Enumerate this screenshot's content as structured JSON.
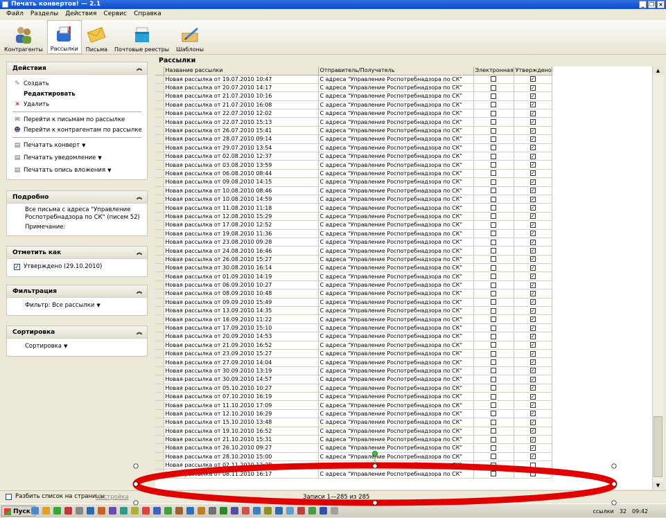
{
  "window": {
    "title": "Печать конвертов! — 2.1"
  },
  "menu": [
    "Файл",
    "Разделы",
    "Действия",
    "Сервис",
    "Справка"
  ],
  "toolbar": [
    {
      "label": "Контрагенты",
      "icon": "contacts-icon"
    },
    {
      "label": "Рассылки",
      "icon": "mailbox-icon",
      "active": true
    },
    {
      "label": "Письма",
      "icon": "envelope-icon"
    },
    {
      "label": "Почтовые реестры",
      "icon": "postal-registry-icon"
    },
    {
      "label": "Шаблоны",
      "icon": "templates-icon"
    }
  ],
  "panels": {
    "actions": {
      "title": "Действия",
      "create": "Создать",
      "edit": "Редактировать",
      "delete": "Удалить",
      "goto_letters": "Перейти к письмам по рассылке",
      "goto_contractors": "Перейти к контрагентам по рассылке",
      "print_envelope": "Печатать конверт",
      "print_notice": "Печатать уведомление",
      "print_inventory": "Печатать опись вложения"
    },
    "details": {
      "title": "Подробно",
      "text": "Все письма с адреса \"Управление Роспотребнадзора по СК\" (писем 52)",
      "note": "Примечание:"
    },
    "mark": {
      "title": "Отметить как",
      "approved": "Утверждено (29.10.2010)"
    },
    "filter": {
      "title": "Фильтрация",
      "label": "Фильтр: Все рассылки"
    },
    "sort": {
      "title": "Сортировка",
      "label": "Сортировка"
    }
  },
  "main": {
    "title": "Рассылки",
    "columns": [
      "Название рассылки",
      "Отправитель/Получатель",
      "Электронная",
      "Утверждено"
    ],
    "sender": "С адреса \"Управление Роспотребнадзора по СК\"",
    "rows": [
      {
        "name": "Новая рассылка от 19.07.2010 10:47",
        "electronic": false,
        "approved": true
      },
      {
        "name": "Новая рассылка от 20.07.2010 14:17",
        "electronic": false,
        "approved": true
      },
      {
        "name": "Новая рассылка от 21.07.2010 10:16",
        "electronic": false,
        "approved": true
      },
      {
        "name": "Новая рассылка от 21.07.2010 16:08",
        "electronic": false,
        "approved": true
      },
      {
        "name": "Новая рассылка от 22.07.2010 12:02",
        "electronic": false,
        "approved": true
      },
      {
        "name": "Новая рассылка от 22.07.2010 15:13",
        "electronic": false,
        "approved": true
      },
      {
        "name": "Новая рассылка от 26.07.2010 15:41",
        "electronic": false,
        "approved": true
      },
      {
        "name": "Новая рассылка от 28.07.2010 09:14",
        "electronic": false,
        "approved": true
      },
      {
        "name": "Новая рассылка от 29.07.2010 13:54",
        "electronic": false,
        "approved": true
      },
      {
        "name": "Новая рассылка от 02.08.2010 12:37",
        "electronic": false,
        "approved": true
      },
      {
        "name": "Новая рассылка от 03.08.2010 13:59",
        "electronic": false,
        "approved": true
      },
      {
        "name": "Новая рассылка от 06.08.2010 08:44",
        "electronic": false,
        "approved": true
      },
      {
        "name": "Новая рассылка от 09.08.2010 14:15",
        "electronic": false,
        "approved": true
      },
      {
        "name": "Новая рассылка от 10.08.2010 08:46",
        "electronic": false,
        "approved": true
      },
      {
        "name": "Новая рассылка от 10.08.2010 14:59",
        "electronic": false,
        "approved": true
      },
      {
        "name": "Новая рассылка от 11.08.2010 11:18",
        "electronic": false,
        "approved": true
      },
      {
        "name": "Новая рассылка от 12.08.2010 15:29",
        "electronic": false,
        "approved": true
      },
      {
        "name": "Новая рассылка от 17.08.2010 12:52",
        "electronic": false,
        "approved": true
      },
      {
        "name": "Новая рассылка от 19.08.2010 11:36",
        "electronic": false,
        "approved": true
      },
      {
        "name": "Новая рассылка от 23.08.2010 09:28",
        "electronic": false,
        "approved": true
      },
      {
        "name": "Новая рассылка от 24.08.2010 16:46",
        "electronic": false,
        "approved": true
      },
      {
        "name": "Новая рассылка от 26.08.2010 15:27",
        "electronic": false,
        "approved": true
      },
      {
        "name": "Новая рассылка от 30.08.2010 16:14",
        "electronic": false,
        "approved": true
      },
      {
        "name": "Новая рассылка от 01.09.2010 14:19",
        "electronic": false,
        "approved": true
      },
      {
        "name": "Новая рассылка от 06.09.2010 10:27",
        "electronic": false,
        "approved": true
      },
      {
        "name": "Новая рассылка от 08.09.2010 10:48",
        "electronic": false,
        "approved": true
      },
      {
        "name": "Новая рассылка от 09.09.2010 15:49",
        "electronic": false,
        "approved": true
      },
      {
        "name": "Новая рассылка от 13.09.2010 14:35",
        "electronic": false,
        "approved": true
      },
      {
        "name": "Новая рассылка от 16.09.2010 11:22",
        "electronic": false,
        "approved": true
      },
      {
        "name": "Новая рассылка от 17.09.2010 15:10",
        "electronic": false,
        "approved": true
      },
      {
        "name": "Новая рассылка от 20.09.2010 14:53",
        "electronic": false,
        "approved": true
      },
      {
        "name": "Новая рассылка от 21.09.2010 16:52",
        "electronic": false,
        "approved": true
      },
      {
        "name": "Новая рассылка от 23.09.2010 15:27",
        "electronic": false,
        "approved": true
      },
      {
        "name": "Новая рассылка от 27.09.2010 14:04",
        "electronic": false,
        "approved": true
      },
      {
        "name": "Новая рассылка от 30.09.2010 13:19",
        "electronic": false,
        "approved": true
      },
      {
        "name": "Новая рассылка от 30.09.2010 14:57",
        "electronic": false,
        "approved": true
      },
      {
        "name": "Новая рассылка от 05.10.2010 10:27",
        "electronic": false,
        "approved": true
      },
      {
        "name": "Новая рассылка от 07.10.2010 16:19",
        "electronic": false,
        "approved": true
      },
      {
        "name": "Новая рассылка от 11.10.2010 17:09",
        "electronic": false,
        "approved": true
      },
      {
        "name": "Новая рассылка от 12.10.2010 16:29",
        "electronic": false,
        "approved": true
      },
      {
        "name": "Новая рассылка от 15.10.2010 13:48",
        "electronic": false,
        "approved": true
      },
      {
        "name": "Новая рассылка от 19.10.2010 16:52",
        "electronic": false,
        "approved": true
      },
      {
        "name": "Новая рассылка от 21.10.2010 15:31",
        "electronic": false,
        "approved": true
      },
      {
        "name": "Новая рассылка от 26.10.2010 09:27",
        "electronic": false,
        "approved": true
      },
      {
        "name": "Новая рассылка от 28.10.2010 15:00",
        "electronic": false,
        "approved": true
      },
      {
        "name": "Новая рассылка от 02.11.2010 12:28",
        "electronic": false,
        "approved": false
      },
      {
        "name": "Новая рассылка от 08.11.2010 16:17",
        "electronic": false,
        "approved": false
      }
    ]
  },
  "status": {
    "split_label": "Разбить список на страницы",
    "settings_link": "Настройка",
    "count": "Записи 1—285 из 285"
  },
  "taskbar": {
    "start": "Пуск",
    "tray_text": "ссылки",
    "tray_num": "32",
    "clock": "09:42"
  },
  "colors": {
    "annotation": "#e00000",
    "handle": "#ffffff",
    "rotate_handle": "#33cc33"
  }
}
